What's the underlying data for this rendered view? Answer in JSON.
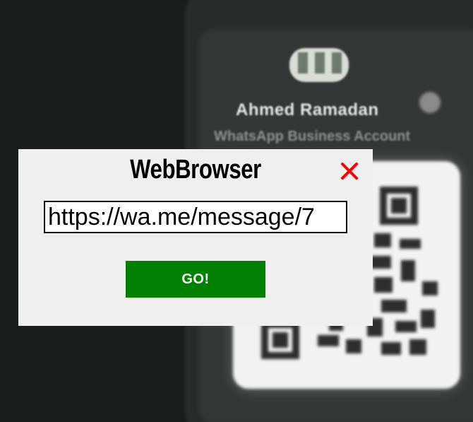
{
  "background": {
    "contact_name": "Ahmed Ramadan",
    "account_type": "WhatsApp Business Account"
  },
  "dialog": {
    "title": "WebBrowser",
    "close_icon": "close-icon",
    "url_value": "https://wa.me/message/7",
    "go_label": "GO!"
  },
  "colors": {
    "dialog_bg": "#efefef",
    "close": "#ff0000",
    "go_button": "#008000"
  }
}
